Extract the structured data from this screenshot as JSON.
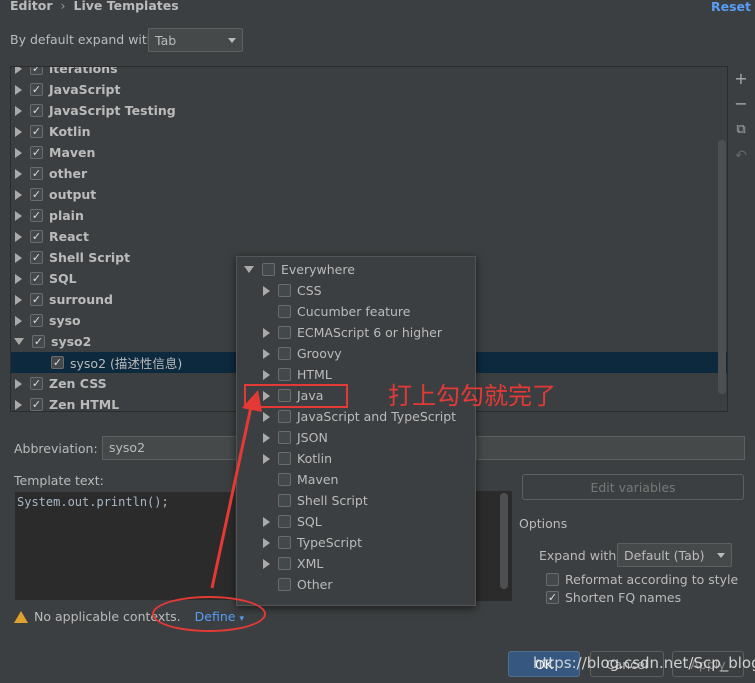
{
  "header": {
    "breadcrumb_root": "Editor",
    "breadcrumb_separator": "›",
    "breadcrumb_current": "Live Templates",
    "reset_label": "Reset"
  },
  "expand_default": {
    "label": "By default expand with",
    "value": "Tab"
  },
  "tree": {
    "items": [
      {
        "label": "iterations",
        "checked": true,
        "expanded": false
      },
      {
        "label": "JavaScript",
        "checked": true,
        "expanded": false
      },
      {
        "label": "JavaScript Testing",
        "checked": true,
        "expanded": false
      },
      {
        "label": "Kotlin",
        "checked": true,
        "expanded": false
      },
      {
        "label": "Maven",
        "checked": true,
        "expanded": false
      },
      {
        "label": "other",
        "checked": true,
        "expanded": false
      },
      {
        "label": "output",
        "checked": true,
        "expanded": false
      },
      {
        "label": "plain",
        "checked": true,
        "expanded": false
      },
      {
        "label": "React",
        "checked": true,
        "expanded": false
      },
      {
        "label": "Shell Script",
        "checked": true,
        "expanded": false
      },
      {
        "label": "SQL",
        "checked": true,
        "expanded": false
      },
      {
        "label": "surround",
        "checked": true,
        "expanded": false
      },
      {
        "label": "syso",
        "checked": true,
        "expanded": false
      },
      {
        "label": "syso2",
        "checked": true,
        "expanded": true
      },
      {
        "label": "syso2 (描述性信息)",
        "checked": true,
        "child": true,
        "selected": true
      },
      {
        "label": "Zen CSS",
        "checked": true,
        "expanded": false
      },
      {
        "label": "Zen HTML",
        "checked": true,
        "expanded": false
      }
    ]
  },
  "toolbar": {
    "add_icon": "plus-icon",
    "remove_icon": "minus-icon",
    "copy_icon": "copy-icon",
    "undo_icon": "undo-icon"
  },
  "form": {
    "abbreviation_label": "Abbreviation:",
    "abbreviation_value": "syso2",
    "template_text_label": "Template text:",
    "template_text_value": "System.out.println();",
    "edit_variables_label": "Edit variables",
    "options_label": "Options",
    "expand_with_label": "Expand with",
    "expand_with_value": "Default (Tab)",
    "reformat_label": "Reformat according to style",
    "reformat_checked": false,
    "shorten_label": "Shorten FQ names",
    "shorten_checked": true,
    "no_contexts_label": "No applicable contexts.",
    "define_label": "Define"
  },
  "context_popup": {
    "items": [
      {
        "label": "Everywhere",
        "expanded": true,
        "level": 0,
        "arrow": true
      },
      {
        "label": "CSS",
        "level": 1,
        "arrow": true
      },
      {
        "label": "Cucumber feature",
        "level": 1,
        "arrow": false
      },
      {
        "label": "ECMAScript 6 or higher",
        "level": 1,
        "arrow": true
      },
      {
        "label": "Groovy",
        "level": 1,
        "arrow": true
      },
      {
        "label": "HTML",
        "level": 1,
        "arrow": true
      },
      {
        "label": "Java",
        "level": 1,
        "arrow": true
      },
      {
        "label": "JavaScript and TypeScript",
        "level": 1,
        "arrow": true
      },
      {
        "label": "JSON",
        "level": 1,
        "arrow": true
      },
      {
        "label": "Kotlin",
        "level": 1,
        "arrow": true
      },
      {
        "label": "Maven",
        "level": 1,
        "arrow": false
      },
      {
        "label": "Shell Script",
        "level": 1,
        "arrow": false
      },
      {
        "label": "SQL",
        "level": 1,
        "arrow": true
      },
      {
        "label": "TypeScript",
        "level": 1,
        "arrow": true
      },
      {
        "label": "XML",
        "level": 1,
        "arrow": true
      },
      {
        "label": "Other",
        "level": 1,
        "arrow": false
      }
    ]
  },
  "annotation": {
    "text": "打上勾勾就完了",
    "color": "#e53935"
  },
  "buttons": {
    "ok_label": "OK",
    "cancel_label": "Cancel",
    "apply_label": "Apply"
  },
  "watermark": "https://blog.csdn.net/Scp_blog",
  "colors": {
    "background": "#3c3f41",
    "link": "#589df6",
    "selection": "#0d293e",
    "annotation": "#e53935"
  }
}
